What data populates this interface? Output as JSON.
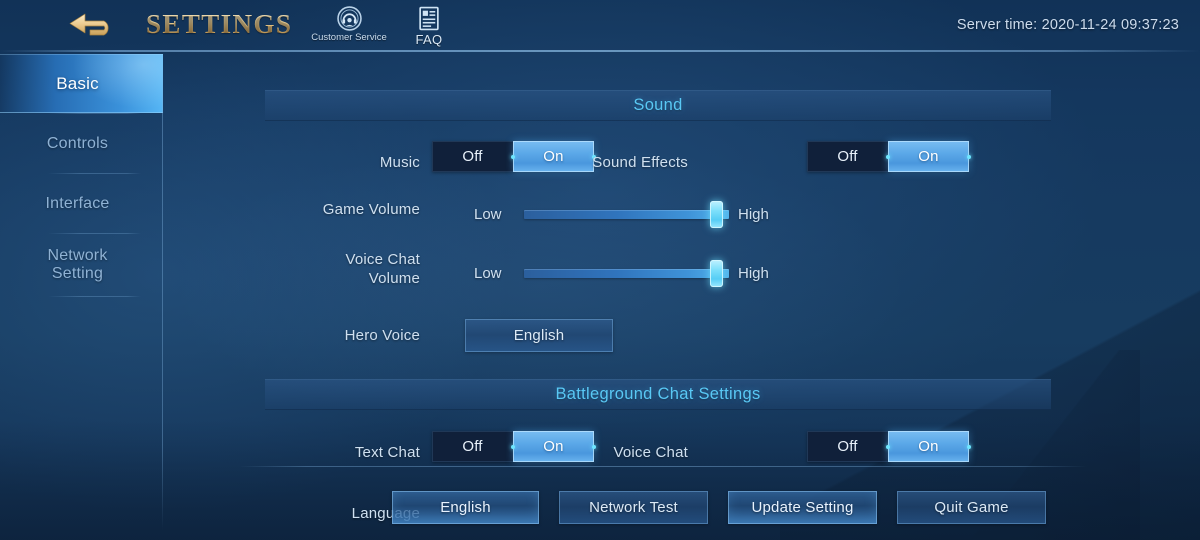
{
  "header": {
    "back_icon": "back-arrow-icon",
    "title": "SETTINGS",
    "customer_service": {
      "icon": "headset-icon",
      "label": "Customer Service"
    },
    "faq": {
      "icon": "document-icon",
      "label": "FAQ"
    },
    "server_time": "Server time: 2020-11-24 09:37:23"
  },
  "sidebar": {
    "items": [
      {
        "label": "Basic",
        "active": true
      },
      {
        "label": "Controls",
        "active": false
      },
      {
        "label": "Interface",
        "active": false
      },
      {
        "label": "Network Setting",
        "active": false
      }
    ]
  },
  "sections": {
    "sound": {
      "title": "Sound",
      "music": {
        "label": "Music",
        "off": "Off",
        "on": "On",
        "value": "On"
      },
      "sound_effects": {
        "label": "Sound Effects",
        "off": "Off",
        "on": "On",
        "value": "On"
      },
      "game_volume": {
        "label": "Game Volume",
        "low": "Low",
        "high": "High",
        "value": 97
      },
      "voice_chat_volume": {
        "label_line1": "Voice Chat",
        "label_line2": "Volume",
        "low": "Low",
        "high": "High",
        "value": 97
      },
      "hero_voice": {
        "label": "Hero Voice",
        "value": "English"
      }
    },
    "battleground": {
      "title": "Battleground Chat Settings",
      "text_chat": {
        "label": "Text Chat",
        "off": "Off",
        "on": "On",
        "value": "On"
      },
      "voice_chat": {
        "label": "Voice Chat",
        "off": "Off",
        "on": "On",
        "value": "On"
      }
    }
  },
  "footer": {
    "language_label": "Language",
    "language_value": "English",
    "network_test": "Network Test",
    "update_setting": "Update Setting",
    "quit_game": "Quit Game"
  },
  "colors": {
    "accent_cyan": "#59c8f5",
    "toggle_on": "#5ba8e8",
    "title_gold": "#f3d79b",
    "bg_blue": "#163a60",
    "sidebar_active": "#3c96e1"
  }
}
